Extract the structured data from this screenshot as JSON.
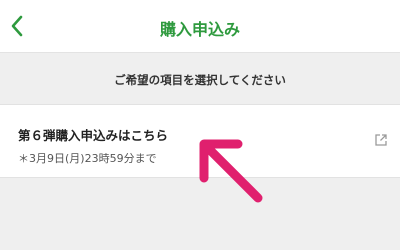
{
  "colors": {
    "brand_green": "#2e9a3e",
    "background": "#efefef",
    "arrow_pink": "#e0206e"
  },
  "header": {
    "back_icon": "chevron-left-icon",
    "title": "購入申込み"
  },
  "instruction": "ご希望の項目を選択してください",
  "option": {
    "title": "第６弾購入申込みはこちら",
    "subtitle": "＊3月9日(月)23時59分まで",
    "icon": "external-link-icon"
  },
  "annotation": {
    "icon": "arrow-up-left-icon"
  }
}
